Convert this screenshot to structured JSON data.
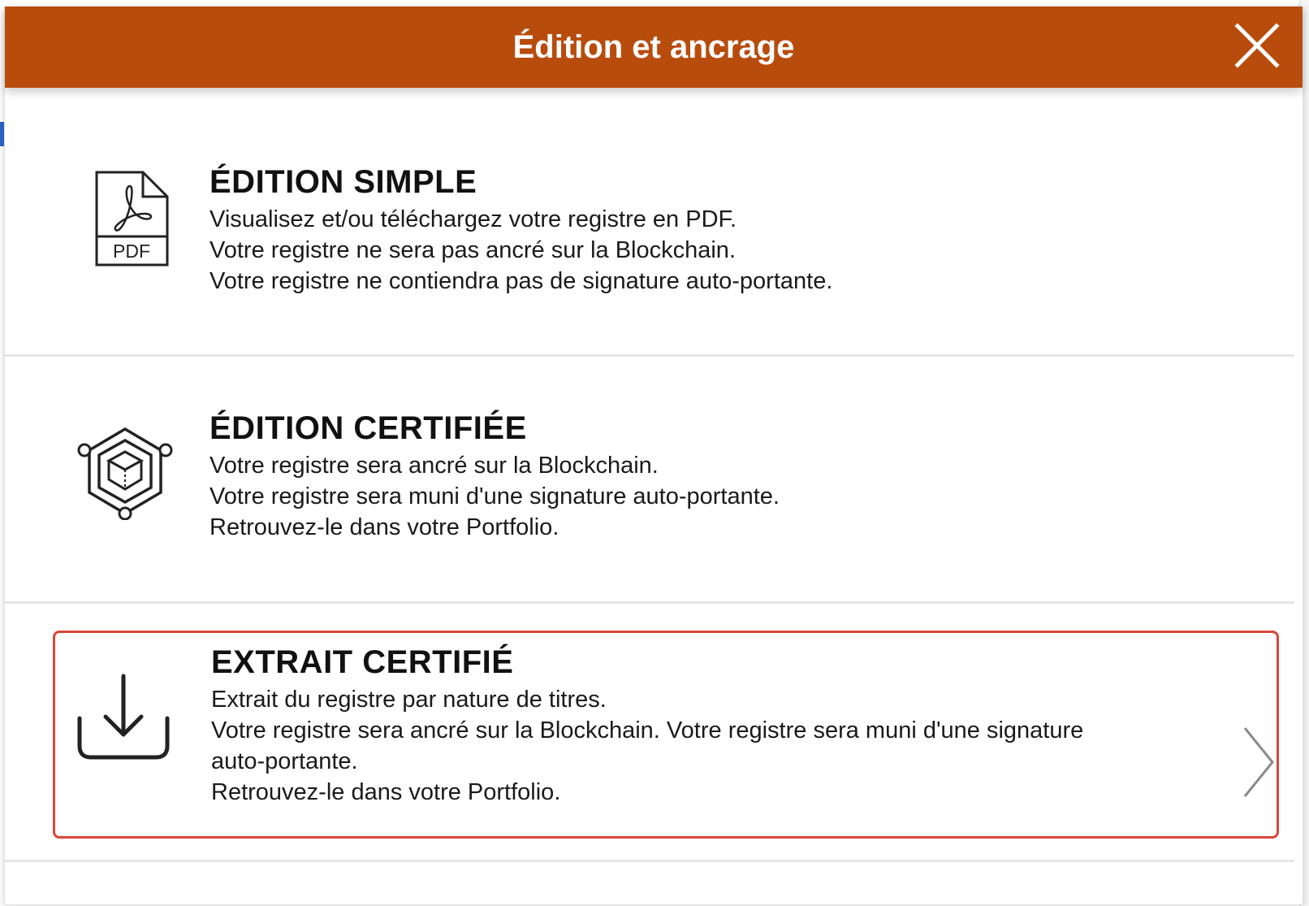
{
  "modal": {
    "title": "Édition et ancrage",
    "header_color": "#b84c0d",
    "close_icon": "close-icon"
  },
  "options": [
    {
      "icon": "pdf-file-icon",
      "title": "ÉDITION SIMPLE",
      "lines": [
        "Visualisez et/ou téléchargez votre registre en PDF.",
        "Votre registre ne sera pas ancré sur la Blockchain.",
        "Votre registre ne contiendra pas de signature auto-portante."
      ],
      "icon_label": "PDF"
    },
    {
      "icon": "blockchain-cube-icon",
      "title": "ÉDITION CERTIFIÉE",
      "lines": [
        "Votre registre sera ancré sur la Blockchain.",
        "Votre registre sera muni d'une signature auto-portante.",
        "Retrouvez-le dans votre Portfolio."
      ]
    },
    {
      "icon": "download-icon",
      "title": "EXTRAIT CERTIFIÉ",
      "lines": [
        "Extrait du registre par nature de titres.",
        "Votre registre sera ancré sur la Blockchain. Votre registre sera muni d'une signature",
        "auto-portante.",
        "Retrouvez-le dans votre Portfolio."
      ],
      "highlighted": true,
      "highlight_color": "#d9473a",
      "trailing_icon": "chevron-right-icon"
    }
  ]
}
